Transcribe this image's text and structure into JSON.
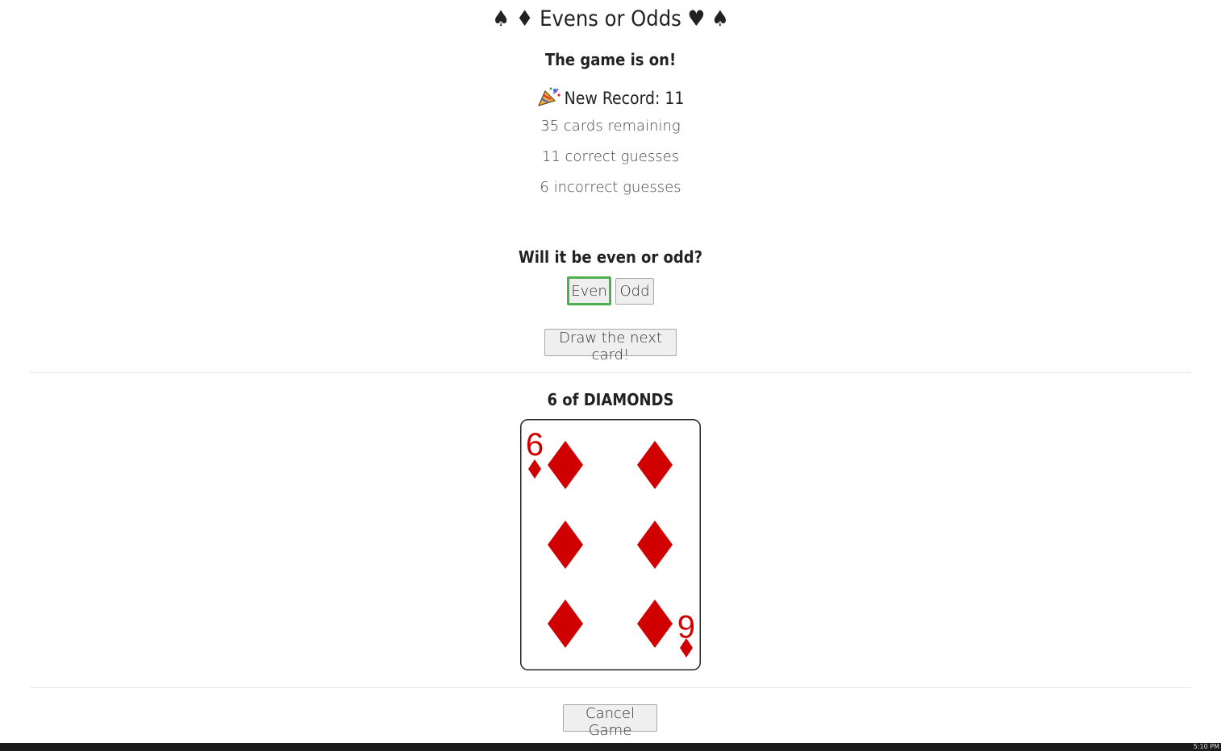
{
  "header": {
    "title": "♠ ♦ Evens or Odds ♥ ♠"
  },
  "game": {
    "status": "The game is on!",
    "record_label": "New Record: 11",
    "cards_remaining": "35 cards remaining",
    "correct": "11 correct guesses",
    "incorrect": "6 incorrect guesses"
  },
  "guess": {
    "question": "Will it be even or odd?",
    "even_label": "Even",
    "odd_label": "Odd",
    "selected": "Even"
  },
  "actions": {
    "draw_label": "Draw the next card!",
    "cancel_label": "Cancel Game"
  },
  "card": {
    "name": "6 of DIAMONDS",
    "rank": "6",
    "suit": "diamonds",
    "suit_color": "#d10000"
  },
  "colors": {
    "selected_border": "#4caf50"
  },
  "taskbar": {
    "clock": "5:10 PM"
  }
}
